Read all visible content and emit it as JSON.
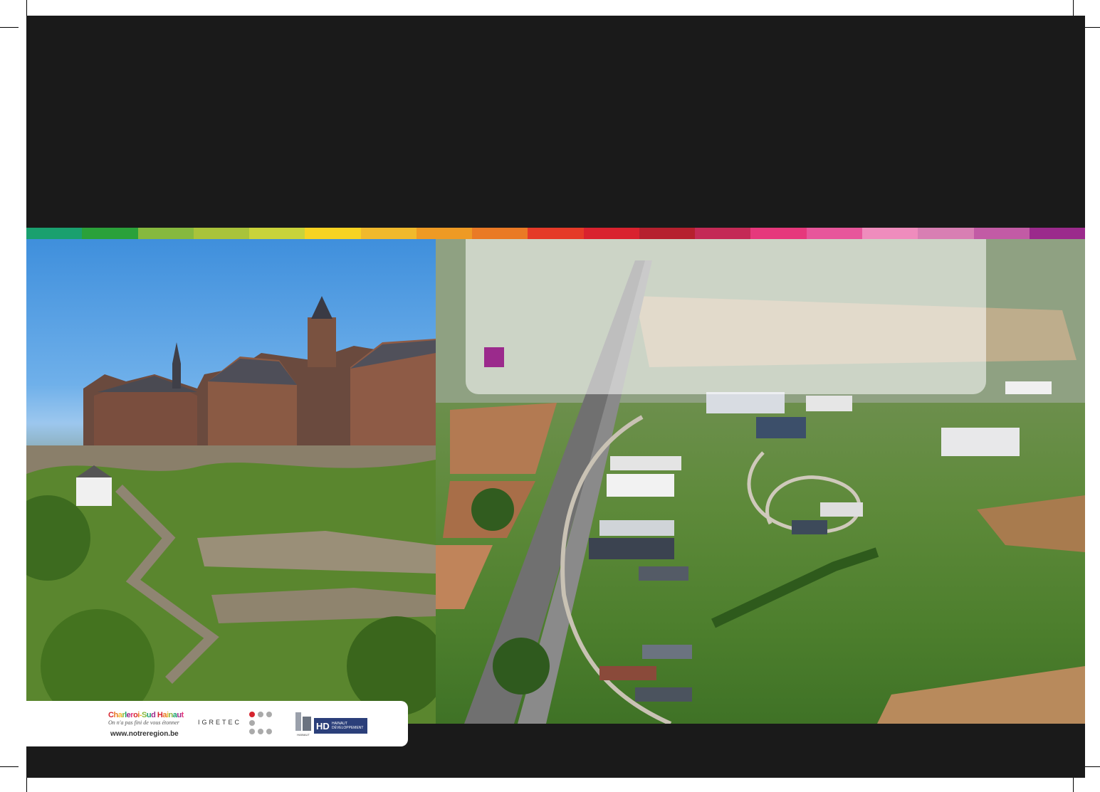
{
  "stripe_colors": [
    "#1aa06f",
    "#2aa13a",
    "#86b93e",
    "#a9c33a",
    "#c9d33a",
    "#f6d322",
    "#f0b92c",
    "#ee9a24",
    "#ea7a25",
    "#e53a28",
    "#d9222e",
    "#b6202e",
    "#c42a56",
    "#e6387c",
    "#e7569b",
    "#ef8cbd",
    "#d87fb3",
    "#c25ba5",
    "#9b2a8c"
  ],
  "accent_color": "#9b2a8c",
  "logo_card": {
    "brand_name": "Charleroi-Sud Hainaut",
    "brand_tagline": "On n'a pas fini de vous étonner",
    "brand_url": "www.notreregion.be",
    "igretec": "IGRETEC",
    "hainaut_label": "HAINAUT",
    "hd_letters": "HD",
    "hd_line1": "HAINAUT",
    "hd_line2": "DÉVELOPPEMENT"
  }
}
